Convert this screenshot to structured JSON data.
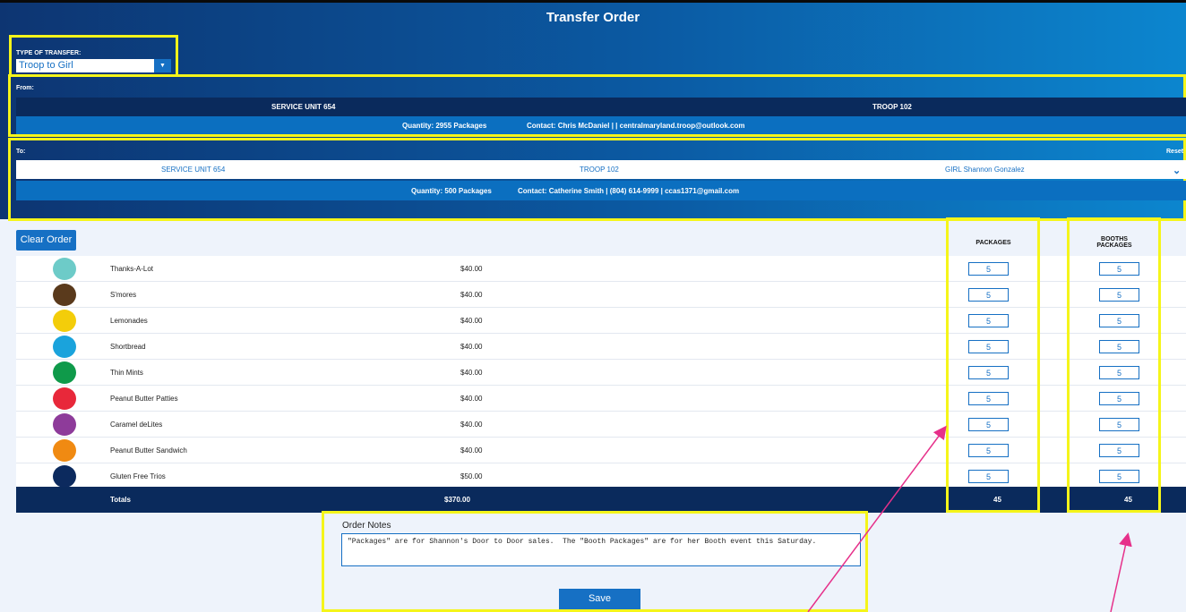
{
  "title": "Transfer Order",
  "transfer_type": {
    "label": "TYPE OF TRANSFER:",
    "value": "Troop to Girl"
  },
  "from": {
    "label": "From:",
    "service_unit": "SERVICE UNIT 654",
    "troop": "TROOP 102",
    "quantity_label": "Quantity:",
    "quantity": "2955 Packages",
    "contact_label": "Contact:",
    "contact": "Chris McDaniel | | centralmaryland.troop@outlook.com"
  },
  "to": {
    "label": "To:",
    "reset_label": "Reset",
    "service_unit": "SERVICE UNIT 654",
    "troop": "TROOP 102",
    "girl": "GIRL Shannon Gonzalez",
    "quantity_label": "Quantity:",
    "quantity": "500 Packages",
    "contact_label": "Contact:",
    "contact": "Catherine Smith | (804) 614-9999 | ccas1371@gmail.com"
  },
  "clear_order_label": "Clear Order",
  "columns": {
    "packages": "PACKAGES",
    "booths_line1": "BOOTHS",
    "booths_line2": "PACKAGES"
  },
  "products": [
    {
      "name": "Thanks-A-Lot",
      "price": "$40.00",
      "packages": "5",
      "booth_packages": "5",
      "color": "#6dcbc8"
    },
    {
      "name": "S'mores",
      "price": "$40.00",
      "packages": "5",
      "booth_packages": "5",
      "color": "#5a3a1c"
    },
    {
      "name": "Lemonades",
      "price": "$40.00",
      "packages": "5",
      "booth_packages": "5",
      "color": "#f3cd0a"
    },
    {
      "name": "Shortbread",
      "price": "$40.00",
      "packages": "5",
      "booth_packages": "5",
      "color": "#1aa3dc"
    },
    {
      "name": "Thin Mints",
      "price": "$40.00",
      "packages": "5",
      "booth_packages": "5",
      "color": "#0f9a4a"
    },
    {
      "name": "Peanut Butter Patties",
      "price": "$40.00",
      "packages": "5",
      "booth_packages": "5",
      "color": "#e8283a"
    },
    {
      "name": "Caramel deLites",
      "price": "$40.00",
      "packages": "5",
      "booth_packages": "5",
      "color": "#8e3b9a"
    },
    {
      "name": "Peanut Butter Sandwich",
      "price": "$40.00",
      "packages": "5",
      "booth_packages": "5",
      "color": "#f08a12"
    },
    {
      "name": "Gluten Free Trios",
      "price": "$50.00",
      "packages": "5",
      "booth_packages": "5",
      "color": "#0c2a5e"
    }
  ],
  "totals": {
    "label": "Totals",
    "amount": "$370.00",
    "packages": "45",
    "booth_packages": "45"
  },
  "notes": {
    "label": "Order Notes",
    "value": "\"Packages\" are for Shannon's Door to Door sales.  The \"Booth Packages\" are for her Booth event this Saturday."
  },
  "save_label": "Save",
  "colors": {
    "accent": "#1670c4",
    "dark_band": "#0a2a5c",
    "highlight": "#f5f51a",
    "annotation_arrow": "#e6308a"
  }
}
